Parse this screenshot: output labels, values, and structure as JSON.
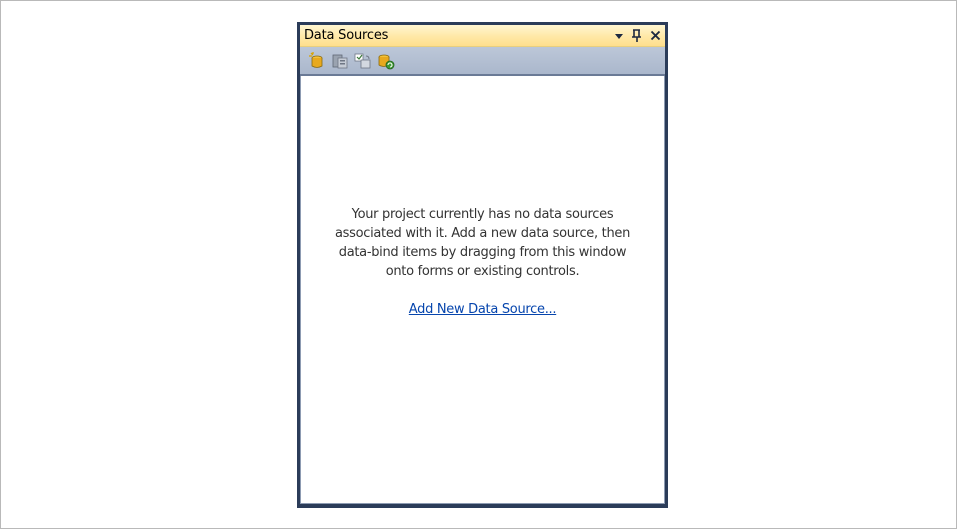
{
  "panel": {
    "title": "Data Sources",
    "buttons": {
      "dropdown_icon": "chevron-down-icon",
      "pin_icon": "pin-icon",
      "close_icon": "close-icon"
    }
  },
  "toolbar": {
    "items": [
      {
        "icon": "add-data-source-icon"
      },
      {
        "icon": "edit-dataset-designer-icon"
      },
      {
        "icon": "configure-dataset-icon"
      },
      {
        "icon": "refresh-icon"
      }
    ]
  },
  "content": {
    "message_lines": [
      "Your project currently has no data sources",
      "associated with it. Add a new data source, then",
      "data-bind items by dragging from this window",
      "onto forms or existing controls."
    ],
    "link_label": "Add New Data Source..."
  },
  "colors": {
    "title_bar": "#ffe8a6",
    "toolbar": "#aab7cc",
    "panel_frame": "#2b3c59",
    "link": "#0645ad",
    "text": "#333333"
  }
}
